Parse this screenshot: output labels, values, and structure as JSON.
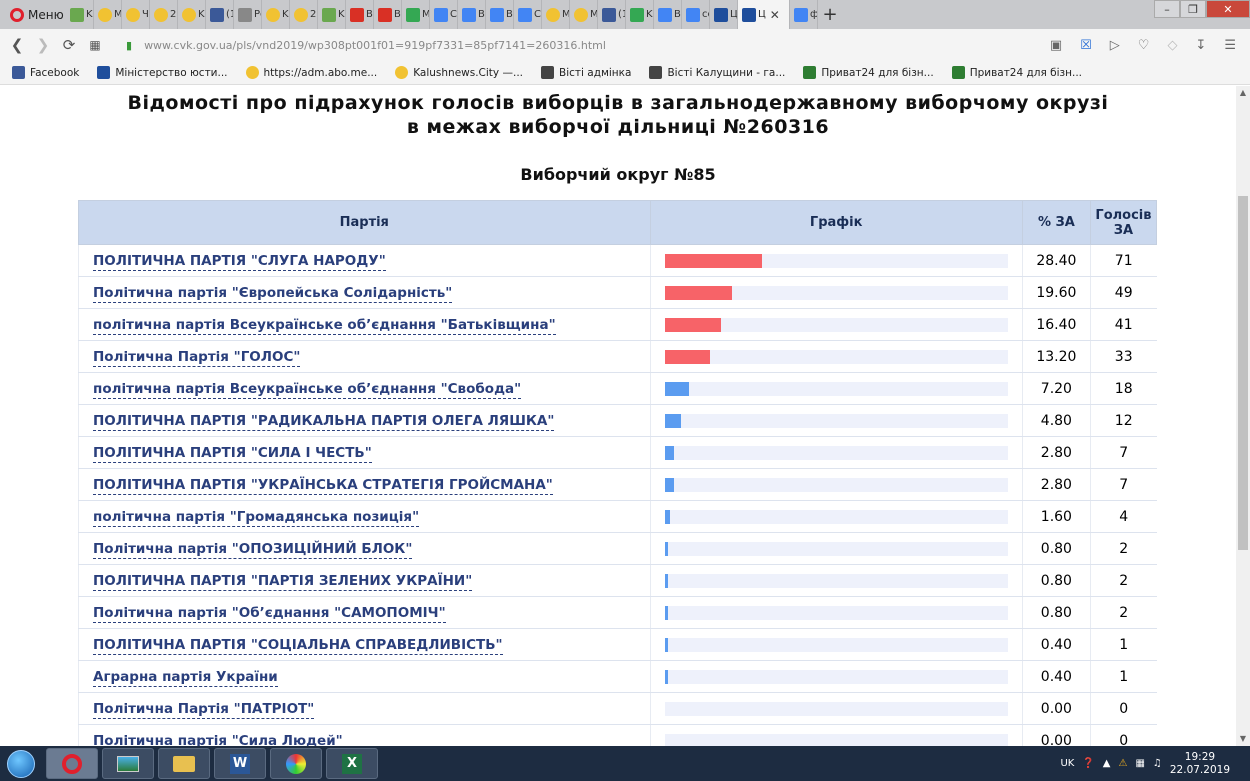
{
  "browser": {
    "menu_label": "Меню",
    "tabs": [
      {
        "label": "Ka",
        "icon": "k-icon",
        "color": "#6aa84f"
      },
      {
        "label": "M",
        "icon": "dot-icon",
        "color": "#f1c232"
      },
      {
        "label": "Чі",
        "icon": "dot-icon",
        "color": "#f1c232"
      },
      {
        "label": "25",
        "icon": "dot-icon",
        "color": "#f1c232"
      },
      {
        "label": "Ka",
        "icon": "dot-icon",
        "color": "#f1c232"
      },
      {
        "label": "(1",
        "icon": "facebook-icon",
        "color": "#3b5998"
      },
      {
        "label": "Pc",
        "icon": "doc-icon",
        "color": "#888888"
      },
      {
        "label": "Ka",
        "icon": "dot-icon",
        "color": "#f1c232"
      },
      {
        "label": "25",
        "icon": "dot-icon",
        "color": "#f1c232"
      },
      {
        "label": "Ka",
        "icon": "k-icon",
        "color": "#6aa84f"
      },
      {
        "label": "Bx",
        "icon": "gmail-icon",
        "color": "#d93025"
      },
      {
        "label": "Bx",
        "icon": "gmail-icon",
        "color": "#d93025"
      },
      {
        "label": "M",
        "icon": "drive-icon",
        "color": "#34a853"
      },
      {
        "label": "Ct",
        "icon": "docs-icon",
        "color": "#4285f4"
      },
      {
        "label": "Bi",
        "icon": "docs-icon",
        "color": "#4285f4"
      },
      {
        "label": "Bi",
        "icon": "docs-icon",
        "color": "#4285f4"
      },
      {
        "label": "C",
        "icon": "docs-icon",
        "color": "#4285f4"
      },
      {
        "label": "M",
        "icon": "dot-icon",
        "color": "#f1c232"
      },
      {
        "label": "M",
        "icon": "dot-icon",
        "color": "#f1c232"
      },
      {
        "label": "(1",
        "icon": "facebook-icon",
        "color": "#3b5998"
      },
      {
        "label": "Ka",
        "icon": "drive-icon",
        "color": "#34a853"
      },
      {
        "label": "Bi",
        "icon": "docs-icon",
        "color": "#4285f4"
      },
      {
        "label": "ce",
        "icon": "google-icon",
        "color": "#4285f4"
      },
      {
        "label": "Ц",
        "icon": "cvk-icon",
        "color": "#1f4e9c"
      },
      {
        "label": "Ц",
        "icon": "cvk-icon",
        "color": "#1f4e9c",
        "active": true
      },
      {
        "label": "ф",
        "icon": "google-icon",
        "color": "#4285f4"
      }
    ],
    "url_host": "www.cvk.gov.ua",
    "url_path": "/pls/vnd2019/wp308pt001f01=919pf7331=85pf7141=260316.html",
    "bookmarks": [
      {
        "label": "Facebook",
        "color": "#3b5998"
      },
      {
        "label": "Міністерство юсти...",
        "color": "#1f4e9c"
      },
      {
        "label": "https://adm.abo.me...",
        "color": "#f1c232"
      },
      {
        "label": "Kalushnews.City —...",
        "color": "#f1c232"
      },
      {
        "label": "Вісті адмінка",
        "color": "#444444"
      },
      {
        "label": "Вісті Калущини - га...",
        "color": "#444444"
      },
      {
        "label": "Приват24 для бізн...",
        "color": "#2e7d32"
      },
      {
        "label": "Приват24 для бізн...",
        "color": "#2e7d32"
      }
    ]
  },
  "page": {
    "title_line1": "Відомості про підрахунок голосів виборців в загальнодержавному виборчому окрузі",
    "title_line2": "в межах виборчої дільниці №260316",
    "subtitle": "Виборчий округ №85",
    "columns": {
      "party": "Партія",
      "graph": "Графік",
      "percent": "% ЗА",
      "votes": "Голосів ЗА"
    },
    "colors": {
      "top_bar": "#f76368",
      "other_bar": "#5b9cf0",
      "track": "#eef1fb"
    },
    "rows": [
      {
        "party": "ПОЛІТИЧНА ПАРТІЯ \"СЛУГА НАРОДУ\"",
        "percent": "28.40",
        "votes": "71",
        "share": 28.4,
        "highlight": true
      },
      {
        "party": "Політична партія \"Європейська Солідарність\"",
        "percent": "19.60",
        "votes": "49",
        "share": 19.6,
        "highlight": true
      },
      {
        "party": "політична партія Всеукраїнське об’єднання \"Батьківщина\"",
        "percent": "16.40",
        "votes": "41",
        "share": 16.4,
        "highlight": true
      },
      {
        "party": "Політична Партія \"ГОЛОС\"",
        "percent": "13.20",
        "votes": "33",
        "share": 13.2,
        "highlight": true
      },
      {
        "party": "політична партія Всеукраїнське об’єднання \"Свобода\"",
        "percent": "7.20",
        "votes": "18",
        "share": 7.2,
        "highlight": false
      },
      {
        "party": "ПОЛІТИЧНА ПАРТІЯ \"РАДИКАЛЬНА ПАРТІЯ ОЛЕГА ЛЯШКА\"",
        "percent": "4.80",
        "votes": "12",
        "share": 4.8,
        "highlight": false
      },
      {
        "party": "ПОЛІТИЧНА ПАРТІЯ \"СИЛА І ЧЕСТЬ\"",
        "percent": "2.80",
        "votes": "7",
        "share": 2.8,
        "highlight": false
      },
      {
        "party": "ПОЛІТИЧНА ПАРТІЯ \"УКРАЇНСЬКА СТРАТЕГІЯ ГРОЙСМАНА\"",
        "percent": "2.80",
        "votes": "7",
        "share": 2.8,
        "highlight": false
      },
      {
        "party": "політична партія \"Громадянська позиція\"",
        "percent": "1.60",
        "votes": "4",
        "share": 1.6,
        "highlight": false
      },
      {
        "party": "Політична партія \"ОПОЗИЦІЙНИЙ БЛОК\"",
        "percent": "0.80",
        "votes": "2",
        "share": 0.8,
        "highlight": false
      },
      {
        "party": "ПОЛІТИЧНА ПАРТІЯ \"ПАРТІЯ ЗЕЛЕНИХ УКРАЇНИ\"",
        "percent": "0.80",
        "votes": "2",
        "share": 0.8,
        "highlight": false
      },
      {
        "party": "Політична партія \"Об’єднання \"САМОПОМІЧ\"",
        "percent": "0.80",
        "votes": "2",
        "share": 0.8,
        "highlight": false
      },
      {
        "party": "ПОЛІТИЧНА ПАРТІЯ \"СОЦІАЛЬНА СПРАВЕДЛИВІСТЬ\"",
        "percent": "0.40",
        "votes": "1",
        "share": 0.4,
        "highlight": false
      },
      {
        "party": "Аграрна партія України",
        "percent": "0.40",
        "votes": "1",
        "share": 0.4,
        "highlight": false
      },
      {
        "party": "Політична Партія \"ПАТРІОТ\"",
        "percent": "0.00",
        "votes": "0",
        "share": 0.0,
        "highlight": false
      },
      {
        "party": "Політична партія \"Сила Людей\"",
        "percent": "0.00",
        "votes": "0",
        "share": 0.0,
        "highlight": false
      }
    ]
  },
  "taskbar": {
    "lang": "UK",
    "time": "19:29",
    "date": "22.07.2019"
  }
}
